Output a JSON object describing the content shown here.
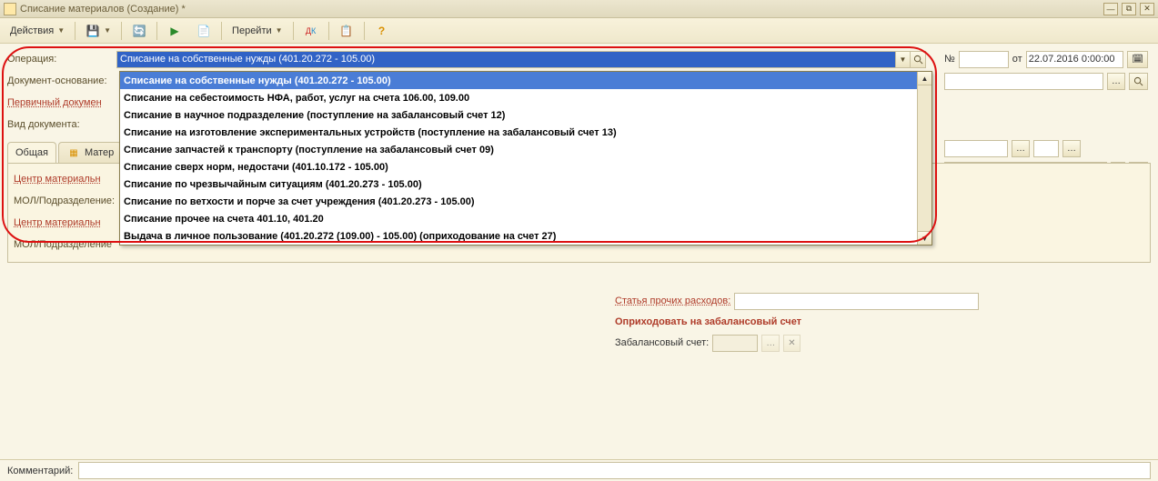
{
  "window": {
    "title": "Списание материалов (Создание) *"
  },
  "toolbar": {
    "actions": "Действия",
    "goto": "Перейти"
  },
  "form": {
    "operation_label": "Операция:",
    "operation_value": "Списание на собственные нужды (401.20.272 - 105.00)",
    "doc_basis_label": "Документ-основание:",
    "primary_doc_label": "Первичный докумен",
    "doc_type_label": "Вид документа:",
    "num_label": "№",
    "from_label": "от",
    "date_value": "22.07.2016 0:00:00"
  },
  "dropdown": [
    "Списание на собственные нужды (401.20.272 - 105.00)",
    "Списание на себестоимость НФА, работ, услуг на счета 106.00, 109.00",
    "Списание в научное подразделение (поступление на забалансовый счет 12)",
    "Списание на изготовление экспериментальных устройств (поступление на забалансовый счет 13)",
    "Списание запчастей к транспорту (поступление на забалансовый счет 09)",
    "Списание сверх норм, недостачи (401.10.172 - 105.00)",
    "Списание по чрезвычайным ситуациям (401.20.273 - 105.00)",
    "Списание по ветхости и порче за счет учреждения (401.20.273 - 105.00)",
    "Списание прочее на счета 401.10, 401.20",
    "Выдача в личное пользование (401.20.272 (109.00) - 105.00) (оприходование на счет 27)"
  ],
  "tabs": {
    "general": "Общая",
    "materials": "Матер"
  },
  "section": {
    "center1": "Центр материальн",
    "mol1": "МОЛ/Подразделение:",
    "center2": "Центр материальн",
    "mol2": "МОЛ/Подразделение"
  },
  "rightpanel": {
    "expense_label": "Статья прочих расходов:",
    "post_heading": "Оприходовать на забалансовый счет",
    "offbalance_label": "Забалансовый счет:"
  },
  "bottom": {
    "comment_label": "Комментарий:"
  }
}
